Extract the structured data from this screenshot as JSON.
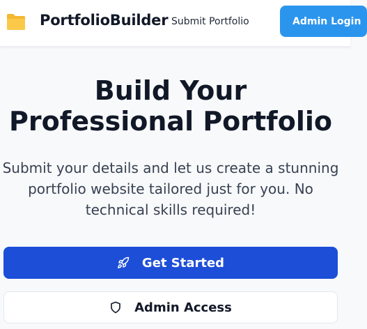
{
  "header": {
    "brand_name": "PortfolioBuilder",
    "brand_icon": "folder-icon",
    "nav_link": "Submit Portfolio",
    "admin_login_label": "Admin Login"
  },
  "hero": {
    "title": "Build Your Professional Portfolio",
    "subtitle": "Submit your details and let us create a stunning portfolio website tailored just for you. No technical skills required!"
  },
  "actions": {
    "get_started_label": "Get Started",
    "get_started_icon": "rocket-icon",
    "admin_access_label": "Admin Access",
    "admin_access_icon": "shield-icon"
  },
  "colors": {
    "primary": "#1d4ed8",
    "accent": "#2b95ee",
    "folder": "#f5b731"
  }
}
